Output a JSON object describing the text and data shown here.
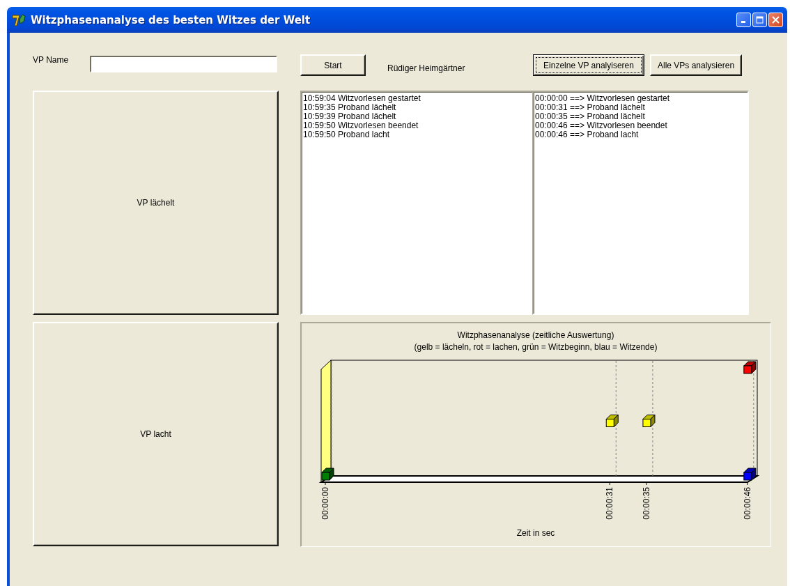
{
  "window": {
    "title": "Witzphasenanalyse des besten Witzes der Welt"
  },
  "name_label": "VP Name",
  "start_button": "Start",
  "person_name": "Rüdiger Heimgärtner",
  "analysis_buttons": [
    {
      "label": "Einzelne VP analyiseren",
      "focused": true
    },
    {
      "label": "Alle VPs analysieren",
      "focused": false
    }
  ],
  "smile_button": "VP lächelt",
  "laugh_button": "VP lacht",
  "event_log": [
    "10:59:04 Witzvorlesen gestartet",
    "10:59:35 Proband lächelt",
    "10:59:39 Proband lächelt",
    "10:59:50 Witzvorlesen beendet",
    "10:59:50 Proband lacht"
  ],
  "relative_log": [
    "00:00:00 ==> Witzvorlesen gestartet",
    "00:00:31 ==> Proband lächelt",
    "00:00:35 ==> Proband lächelt",
    "00:00:46 ==> Witzvorlesen beendet",
    "00:00:46 ==> Proband lacht"
  ],
  "chart": {
    "title": "Witzphasenanalyse (zeitliche Auswertung)",
    "subtitle": "(gelb = lächeln, rot = lachen, grün = Witzbeginn, blau = Witzende)",
    "time_labels": [
      "00:00:00",
      "00:00:31",
      "00:00:35",
      "00:00:46"
    ],
    "axis_label": "Zeit in sec",
    "markers": [
      {
        "color": "#008000"
      },
      {
        "color": "#ffff00"
      },
      {
        "color": "#ffff00"
      },
      {
        "color": "#ff0000"
      },
      {
        "color": "#0000ff"
      }
    ]
  }
}
